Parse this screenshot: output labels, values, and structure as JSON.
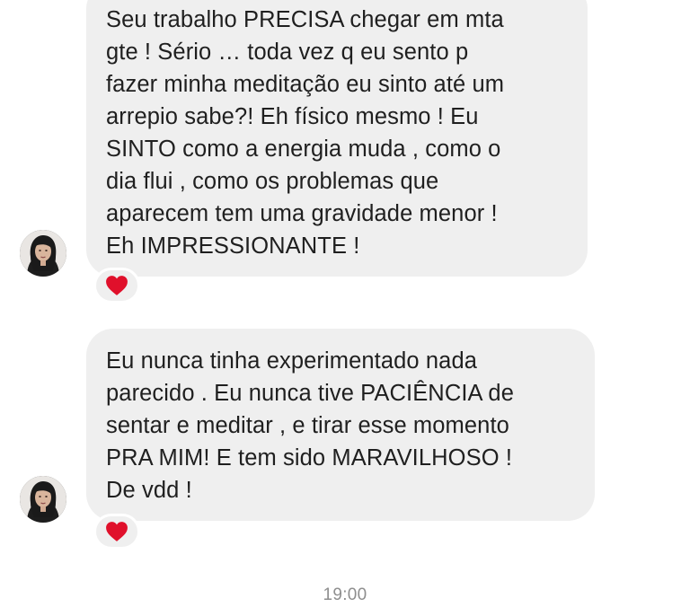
{
  "thread": {
    "messages": [
      {
        "text": "Seu trabalho PRECISA chegar em mta\ngte ! Sério … toda vez q eu sento p\nfazer minha meditação eu sinto até um\narrepio sabe?! Eh físico mesmo ! Eu\nSINTO como a energia muda , como o\ndia flui , como os problemas que\naparecem tem uma gravidade menor !\nEh IMPRESSIONANTE !",
        "reaction": "heart-icon"
      },
      {
        "text": "Eu nunca tinha experimentado nada\nparecido . Eu nunca tive PACIÊNCIA de\nsentar e meditar , e tirar esse momento\nPRA MIM! E tem sido MARAVILHOSO !\nDe vdd !",
        "reaction": "heart-icon"
      }
    ],
    "timestamp": "19:00"
  },
  "colors": {
    "bubble": "#efefef",
    "heart": "#e0102b",
    "timestamp": "#8e8e8e",
    "text": "#1f1f1f"
  }
}
